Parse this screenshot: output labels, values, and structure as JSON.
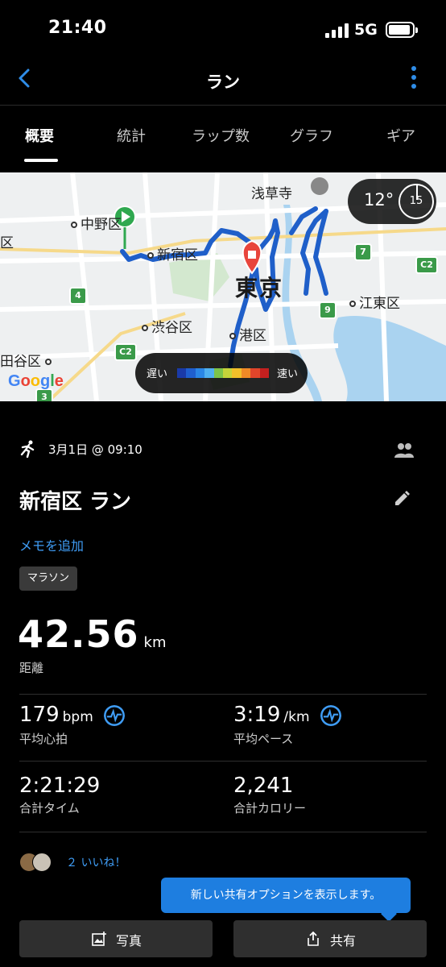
{
  "status_bar": {
    "time": "21:40",
    "network": "5G"
  },
  "header": {
    "title": "ラン"
  },
  "tabs": [
    {
      "label": "概要"
    },
    {
      "label": "統計"
    },
    {
      "label": "ラップ数"
    },
    {
      "label": "グラフ"
    },
    {
      "label": "ギア"
    }
  ],
  "map": {
    "labels": {
      "nakano": "中野区",
      "shinjuku": "新宿区",
      "tokyo": "東京",
      "shibuya": "渋谷区",
      "minato": "港区",
      "koto": "江東区",
      "asakusa": "浅草寺",
      "setagaya": "田谷区",
      "ku": "区"
    },
    "road_signs": {
      "r4": "4",
      "r7": "7",
      "r9": "9",
      "c2a": "C2",
      "c2b": "C2",
      "r3": "3"
    },
    "weather": {
      "temperature": "12°",
      "dial_value": "15"
    },
    "speed_legend": {
      "slow": "遅い",
      "fast": "速い",
      "colors": [
        "#1a3aa8",
        "#1f5fcf",
        "#2a86e6",
        "#4fb0f0",
        "#7cc44a",
        "#c5d43a",
        "#f2c02a",
        "#f08a26",
        "#e0452a",
        "#c4201f"
      ]
    },
    "attribution": "Google"
  },
  "activity": {
    "date": "3月1日 @ 09:10",
    "name": "新宿区 ラン",
    "add_memo": "メモを追加",
    "tag": "マラソン",
    "distance": {
      "value": "42.56",
      "unit": "km",
      "label": "距離"
    }
  },
  "stats": {
    "heart_rate": {
      "value": "179",
      "unit": "bpm",
      "label": "平均心拍"
    },
    "pace": {
      "value": "3:19",
      "unit": "/km",
      "label": "平均ペース"
    },
    "time": {
      "value": "2:21:29",
      "label": "合計タイム"
    },
    "calories": {
      "value": "2,241",
      "label": "合計カロリー"
    }
  },
  "likes": {
    "text": "２ いいね！"
  },
  "tooltip": {
    "text": "新しい共有オプションを表示します。"
  },
  "buttons": {
    "photo": "写真",
    "share": "共有"
  },
  "colors": {
    "accent": "#3f9cf4",
    "route": "#1f5fc9",
    "start": "#2fa84f",
    "finish": "#e8453c"
  }
}
